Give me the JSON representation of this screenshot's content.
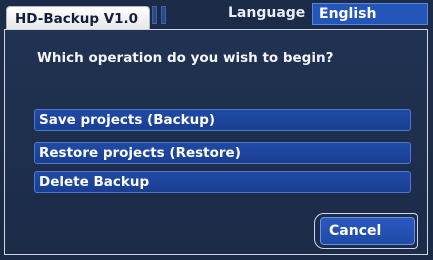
{
  "header": {
    "app_title": "HD-Backup  V1.0",
    "language_label": "Language",
    "language_value": "English"
  },
  "dialog": {
    "question": "Which operation do you wish to begin?",
    "options": [
      {
        "label": "Save projects (Backup)"
      },
      {
        "label": "Restore projects (Restore)"
      },
      {
        "label": "Delete Backup"
      }
    ],
    "cancel_label": "Cancel"
  },
  "colors": {
    "background": "#1b2a45",
    "button_blue": "#1f4aa6",
    "language_highlight": "#2356b8",
    "title_tab": "#ffffff"
  }
}
